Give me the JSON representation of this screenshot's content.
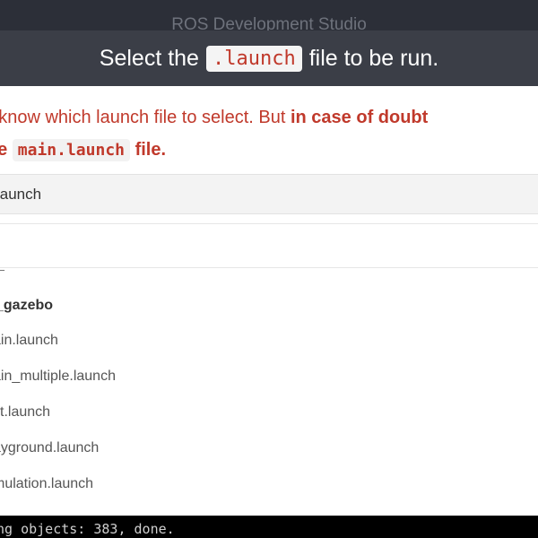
{
  "app": {
    "title": "ROS Development Studio"
  },
  "modal": {
    "header": {
      "prefix": "Select the",
      "code": ".launch",
      "suffix": "file to be run."
    },
    "warning": {
      "line1_normal": "ust know which launch file to select. But",
      "line1_bold": "in case of doubt",
      "line2_bold_prefix": "t the",
      "line2_code": "main.launch",
      "line2_bold_suffix": "file."
    },
    "selected_value": "launch",
    "search": {
      "value": "",
      "placeholder": ""
    },
    "list": {
      "cut_item": "_",
      "group": "_gazebo",
      "items": [
        "ain.launch",
        "ain_multiple.launch",
        "st.launch",
        "ayground.launch",
        "mulation.launch"
      ]
    }
  },
  "terminal": {
    "line1": "",
    "line2": "ng objects: 383, done."
  }
}
